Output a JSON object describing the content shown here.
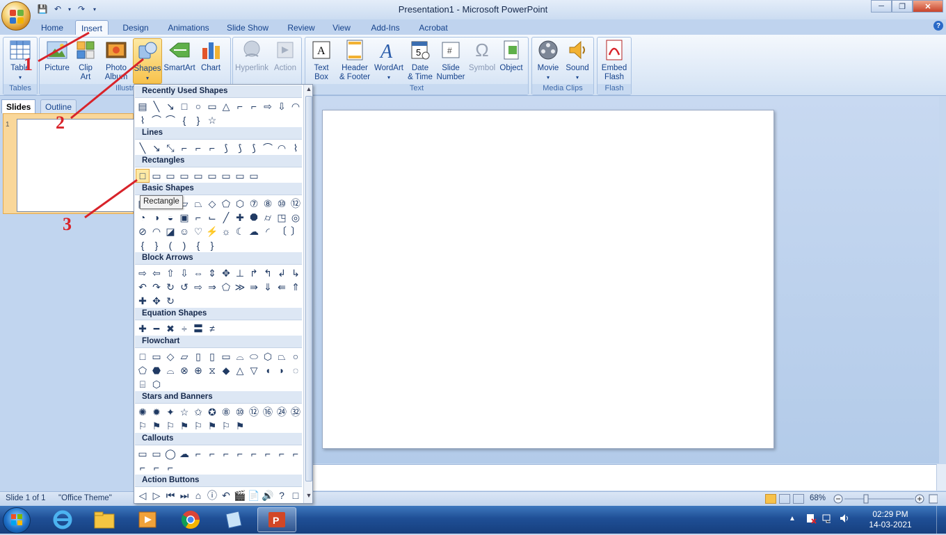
{
  "window": {
    "title": "Presentation1 - Microsoft PowerPoint",
    "min": "─",
    "max": "❐",
    "close": "✕"
  },
  "qat": {
    "save_icon": "save-icon",
    "undo_icon": "undo-icon",
    "redo_icon": "redo-icon",
    "customize_icon": "dropdown-icon"
  },
  "tabs": [
    "Home",
    "Insert",
    "Design",
    "Animations",
    "Slide Show",
    "Review",
    "View",
    "Add-Ins",
    "Acrobat"
  ],
  "active_tab": "Insert",
  "ribbon": {
    "tables": {
      "label": "Tables",
      "table": "Table"
    },
    "illustrations": {
      "label": "Illustrations",
      "picture": "Picture",
      "clipart_1": "Clip",
      "clipart_2": "Art",
      "photo_1": "Photo",
      "photo_2": "Album",
      "shapes": "Shapes",
      "smartart": "SmartArt",
      "chart": "Chart"
    },
    "links": {
      "hyperlink": "Hyperlink",
      "action": "Action"
    },
    "text": {
      "label": "Text",
      "textbox_1": "Text",
      "textbox_2": "Box",
      "header_1": "Header",
      "header_2": "& Footer",
      "wordart": "WordArt",
      "date_1": "Date",
      "date_2": "& Time",
      "slidenum_1": "Slide",
      "slidenum_2": "Number",
      "symbol": "Symbol",
      "object": "Object"
    },
    "media": {
      "label": "Media Clips",
      "movie": "Movie",
      "sound": "Sound"
    },
    "flash": {
      "label": "Flash",
      "embed_1": "Embed",
      "embed_2": "Flash"
    }
  },
  "pane": {
    "slides_tab": "Slides",
    "outline_tab": "Outline",
    "slide_number": "1"
  },
  "gallery": {
    "sections": [
      "Recently Used Shapes",
      "Lines",
      "Rectangles",
      "Basic Shapes",
      "Block Arrows",
      "Equation Shapes",
      "Flowchart",
      "Stars and Banners",
      "Callouts",
      "Action Buttons"
    ],
    "recent": [
      "▤",
      "╲",
      "↘",
      "□",
      "○",
      "▭",
      "△",
      "⌐",
      "⌐",
      "⇨",
      "⇩",
      "◠",
      "⌇",
      "⌒",
      "⌒",
      "{",
      "}",
      "☆"
    ],
    "lines": [
      "╲",
      "↘",
      "⤡",
      "⌐",
      "⌐",
      "⌐",
      "⟆",
      "⟆",
      "⟆",
      "⌒",
      "◠",
      "⌇"
    ],
    "rectangles": [
      "□",
      "▭",
      "▭",
      "▭",
      "▭",
      "▭",
      "▭",
      "▭",
      "▭"
    ],
    "basic": [
      "▤",
      "△",
      "◺",
      "▱",
      "⏢",
      "◇",
      "⬠",
      "⬡",
      "⑦",
      "⑧",
      "⑩",
      "⑫",
      "◔",
      "◑",
      "◒",
      "▣",
      "⌐",
      "⌙",
      "╱",
      "✚",
      "⯃",
      "⌭",
      "◳",
      "◎",
      "⊘",
      "◠",
      "◪",
      "☺",
      "♡",
      "⚡",
      "☼",
      "☾",
      "☁",
      "◜",
      "〔",
      "〕",
      "{",
      "}",
      "(",
      ")",
      "{",
      "}"
    ],
    "block_arrows": [
      "⇨",
      "⇦",
      "⇧",
      "⇩",
      "⇔",
      "⇕",
      "✥",
      "⊥",
      "↱",
      "↰",
      "↲",
      "↳",
      "↶",
      "↷",
      "↻",
      "↺",
      "⇨",
      "⇒",
      "⬠",
      "≫",
      "⇛",
      "⇓",
      "⇚",
      "⇑",
      "✚",
      "✥",
      "↻"
    ],
    "equation": [
      "✚",
      "━",
      "✖",
      "÷",
      "〓",
      "≠"
    ],
    "flowchart": [
      "□",
      "▭",
      "◇",
      "▱",
      "▯",
      "▯",
      "▭",
      "⌓",
      "⬭",
      "⬡",
      "⏢",
      "○",
      "⬠",
      "⬣",
      "⌓",
      "⊗",
      "⊕",
      "⧖",
      "◆",
      "△",
      "▽",
      "◖",
      "◗",
      "◌",
      "⌸",
      "⬡"
    ],
    "stars": [
      "✺",
      "✹",
      "✦",
      "☆",
      "✩",
      "✪",
      "⑧",
      "⑩",
      "⑫",
      "⑯",
      "㉔",
      "㉜",
      "⚐",
      "⚑",
      "⚐",
      "⚑",
      "⚐",
      "⚑",
      "⚐",
      "⚑"
    ],
    "callouts": [
      "▭",
      "▭",
      "◯",
      "☁",
      "⌐",
      "⌐",
      "⌐",
      "⌐",
      "⌐",
      "⌐",
      "⌐",
      "⌐",
      "⌐",
      "⌐",
      "⌐"
    ],
    "action": [
      "◁",
      "▷",
      "⏮",
      "⏭",
      "⌂",
      "ⓘ",
      "↶",
      "🎬",
      "📄",
      "🔊",
      "?",
      "□"
    ]
  },
  "tooltip": "Rectangle",
  "annotations": {
    "one": "1",
    "two": "2",
    "three": "3"
  },
  "statusbar": {
    "slide": "Slide 1 of 1",
    "theme": "\"Office Theme\"",
    "zoom": "68%"
  },
  "taskbar": {
    "time": "02:29 PM",
    "date": "14-03-2021"
  },
  "colors": {
    "accent": "#15428b",
    "annotation": "#d8232a",
    "highlight": "#f7c24b"
  }
}
